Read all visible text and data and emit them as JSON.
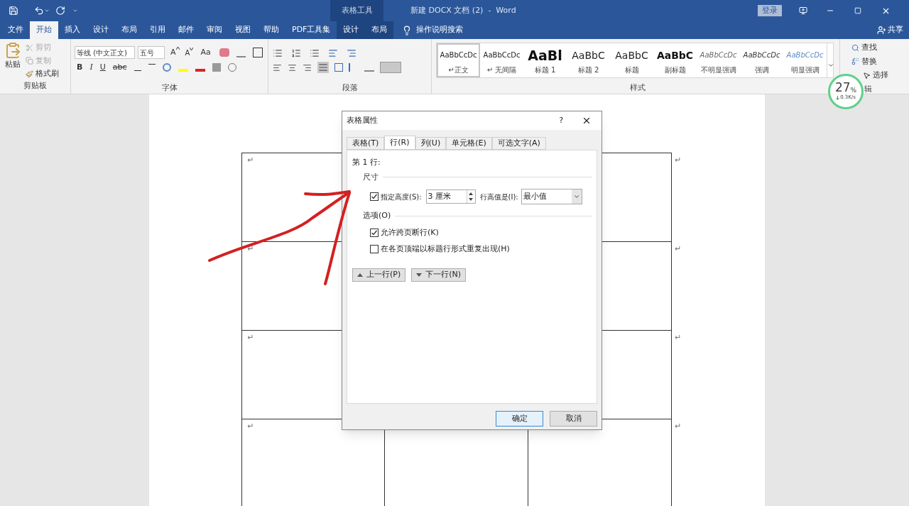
{
  "title_bar": {
    "context_group": "表格工具",
    "title": "新建 DOCX 文档 (2)  -  Word",
    "login": "登录"
  },
  "menu_tabs": [
    {
      "label": "文件",
      "selected": false,
      "contextual": false
    },
    {
      "label": "开始",
      "selected": true,
      "contextual": false
    },
    {
      "label": "插入",
      "selected": false,
      "contextual": false
    },
    {
      "label": "设计",
      "selected": false,
      "contextual": false
    },
    {
      "label": "布局",
      "selected": false,
      "contextual": false
    },
    {
      "label": "引用",
      "selected": false,
      "contextual": false
    },
    {
      "label": "邮件",
      "selected": false,
      "contextual": false
    },
    {
      "label": "审阅",
      "selected": false,
      "contextual": false
    },
    {
      "label": "视图",
      "selected": false,
      "contextual": false
    },
    {
      "label": "帮助",
      "selected": false,
      "contextual": false
    },
    {
      "label": "PDF工具集",
      "selected": false,
      "contextual": false
    },
    {
      "label": "设计",
      "selected": false,
      "contextual": true
    },
    {
      "label": "布局",
      "selected": false,
      "contextual": true
    }
  ],
  "search": {
    "label": "操作说明搜索"
  },
  "share": "共享",
  "clipboard": {
    "paste": "粘贴",
    "cut": {
      "label": "剪切",
      "disabled": true
    },
    "copy": {
      "label": "复制",
      "disabled": true
    },
    "format_painter": "格式刷",
    "group_label": "剪贴板"
  },
  "font": {
    "font_name": "等线 (中文正文)",
    "font_size": "五号",
    "grow_font": "A",
    "shrink_font": "A",
    "change_case": "Aa",
    "buttons": [
      "B",
      "I",
      "U",
      "abc"
    ],
    "group_label": "字体"
  },
  "paragraph": {
    "group_label": "段落"
  },
  "styles": {
    "group_label": "样式",
    "items": [
      {
        "preview": "AaBbCcDc",
        "name": "↵正文",
        "kind": "normal",
        "selected": true
      },
      {
        "preview": "AaBbCcDc",
        "name": "↵ 无间隔",
        "kind": "normal",
        "selected": false
      },
      {
        "preview": "AaBl",
        "name": "标题 1",
        "kind": "heading1",
        "selected": false
      },
      {
        "preview": "AaBbC",
        "name": "标题 2",
        "kind": "heading2",
        "selected": false
      },
      {
        "preview": "AaBbC",
        "name": "标题",
        "kind": "title",
        "selected": false
      },
      {
        "preview": "AaBbC",
        "name": "副标题",
        "kind": "subtitle",
        "selected": false
      },
      {
        "preview": "AaBbCcDc",
        "name": "不明显强调",
        "kind": "subtle",
        "selected": false
      },
      {
        "preview": "AaBbCcDc",
        "name": "强调",
        "kind": "emphasis",
        "selected": false
      },
      {
        "preview": "AaBbCcDc",
        "name": "明显强调",
        "kind": "intense",
        "selected": false
      }
    ]
  },
  "editing": {
    "find": "查找",
    "replace": "替换",
    "select": "选择",
    "group_label": "辑"
  },
  "speed_widget": {
    "percent": "27",
    "unit": "%",
    "rate": "0.3K/s"
  },
  "table": {
    "rows": [
      {
        "cell_mark": "↵",
        "row_end_mark": "↵"
      },
      {
        "cell_mark": "↵",
        "row_end_mark": "↵"
      },
      {
        "cell_mark": "↵",
        "row_end_mark": "↵"
      },
      {
        "cell_mark": "↵",
        "row_end_mark": "↵"
      }
    ]
  },
  "dialog": {
    "title": "表格属性",
    "help": "?",
    "tabs": [
      {
        "label": "表格(T)",
        "selected": false
      },
      {
        "label": "行(R)",
        "selected": true
      },
      {
        "label": "列(U)",
        "selected": false
      },
      {
        "label": "单元格(E)",
        "selected": false
      },
      {
        "label": "可选文字(A)",
        "selected": false
      }
    ],
    "row_label": "第 1 行:",
    "size_section": "尺寸",
    "specify_height": {
      "label": "指定高度(S):",
      "checked": true
    },
    "height_value": "3 厘米",
    "height_rule_label": "行高值是(I):",
    "height_rule": "最小值",
    "options_section": "选项(O)",
    "options": [
      {
        "label": "允许跨页断行(K)",
        "checked": true
      },
      {
        "label": "在各页顶端以标题行形式重复出现(H)",
        "checked": false
      }
    ],
    "prev_row": "上一行(P)",
    "next_row": "下一行(N)",
    "ok": "确定",
    "cancel": "取消"
  }
}
